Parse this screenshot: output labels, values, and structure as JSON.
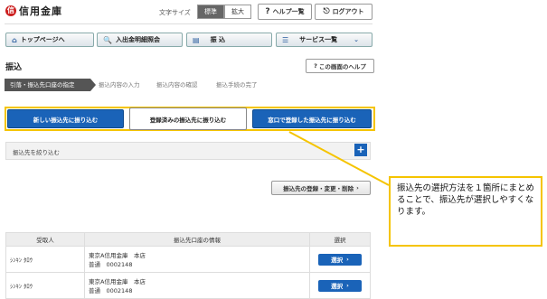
{
  "header": {
    "bank_name": "信用金庫",
    "logo_mark": "信",
    "text_size_label": "文字サイズ",
    "size_standard": "標準",
    "size_large": "拡大",
    "help_list": "ヘルプ一覧",
    "help_icon": "question-icon",
    "logout": "ログアウト",
    "logout_icon": "door-icon"
  },
  "nav": {
    "items": [
      {
        "label": "トップページへ",
        "icon": "home-icon"
      },
      {
        "label": "入出金明細照会",
        "icon": "search-document-icon"
      },
      {
        "label": "振 込",
        "icon": "transfer-icon"
      },
      {
        "label": "サービス一覧",
        "icon": "list-icon"
      }
    ]
  },
  "page": {
    "title": "振込",
    "screen_help": "この画面のヘルプ"
  },
  "steps": [
    "引落・振込先口座の指定",
    "振込内容の入力",
    "振込内容の確認",
    "振込手続の完了"
  ],
  "tabs": [
    "新しい振込先に振り込む",
    "登録済みの振込先に振り込む",
    "窓口で登録した振込先に振り込む"
  ],
  "filter": {
    "label": "振込先を絞り込む",
    "plus": "+"
  },
  "register_button": "振込先の登録・変更・削除",
  "table": {
    "headers": [
      "受取人",
      "振込先口座の情報",
      "選択"
    ],
    "rows": [
      {
        "name": "ｼﾝｷﾝ ﾀﾛｳ",
        "bank": "東京A信用金庫　本店",
        "account": "普通　0002148",
        "select": "選択"
      },
      {
        "name": "ｼﾝｷﾝ ﾀﾛｳ",
        "bank": "東京A信用金庫　本店",
        "account": "普通　0002148",
        "select": "選択"
      }
    ]
  },
  "callout": {
    "text": "振込先の選択方法を１箇所にまとめることで、振込先が選択しやすくなります。"
  },
  "colors": {
    "accent_blue": "#1a63b8",
    "highlight_yellow": "#f5c400",
    "logo_red": "#cc1f1f"
  }
}
